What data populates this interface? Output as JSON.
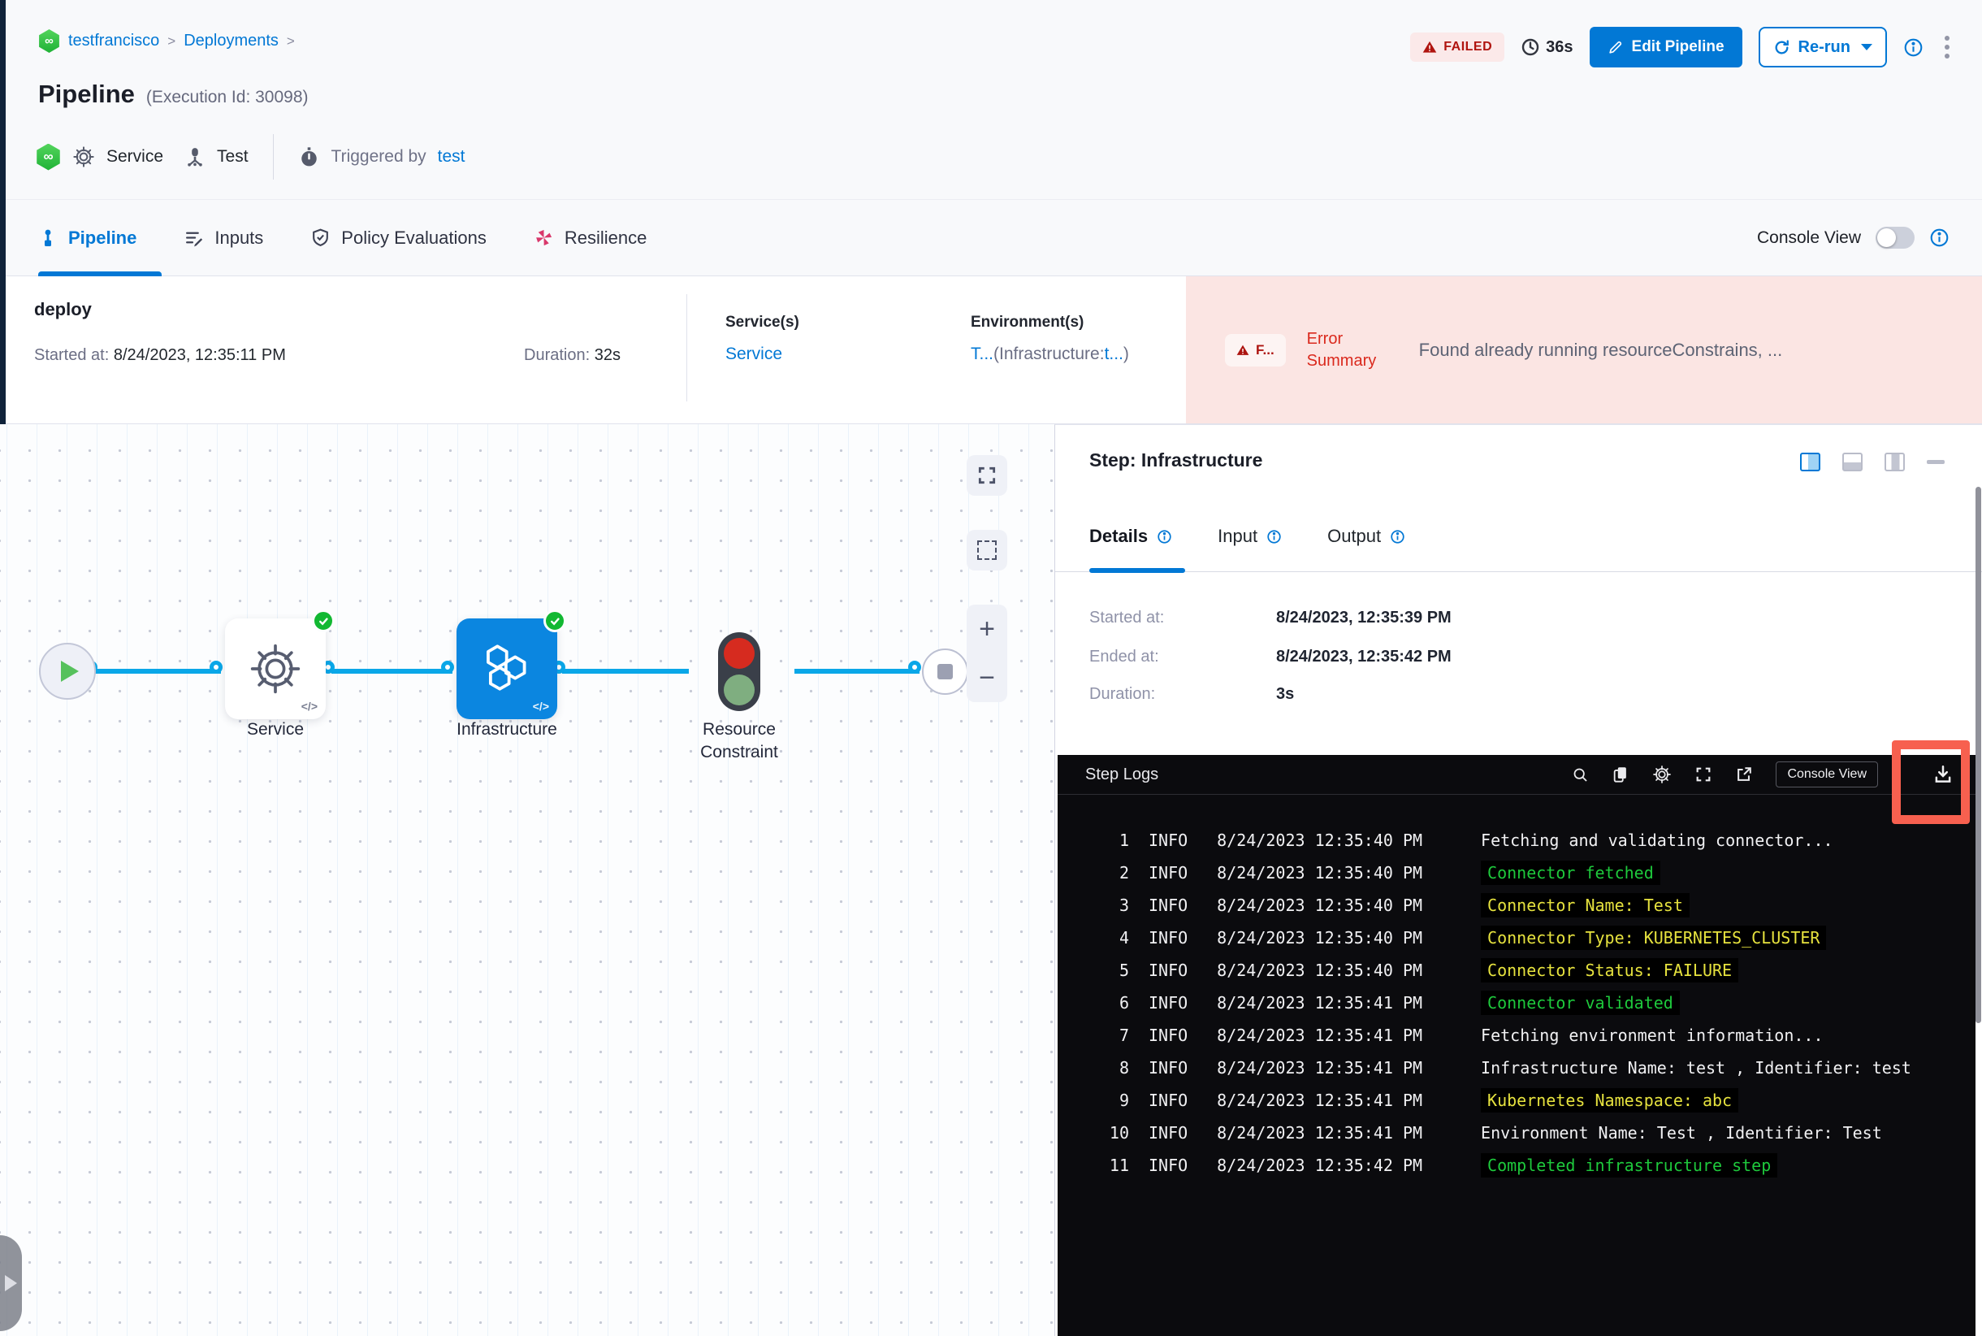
{
  "colors": {
    "accent_blue": "#0278d5",
    "failed_red": "#b0140f",
    "error_red": "#da291d",
    "error_bg_pink": "#fbe5e3",
    "node_blue": "#0b86e0",
    "edge_blue": "#0aa7e8",
    "success_green": "#12b832",
    "log_green": "#1ec93c",
    "log_yellow": "#e6e23e",
    "highlight_red": "#f7604f",
    "console_bg": "#0b0b0e"
  },
  "breadcrumb": {
    "project": "testfrancisco",
    "section": "Deployments",
    "separator": ">"
  },
  "header": {
    "title": "Pipeline",
    "execution_id": "(Execution Id: 30098)",
    "infinity_glyph": "∞",
    "service_name": "Service",
    "environment_name": "Test",
    "triggered_by_label": "Triggered by",
    "triggered_by_value": "test",
    "status_badge": "FAILED",
    "total_duration": "36s",
    "edit_pipeline_label": "Edit Pipeline",
    "rerun_label": "Re-run"
  },
  "tabs": {
    "pipeline": "Pipeline",
    "inputs": "Inputs",
    "policy_evaluations": "Policy Evaluations",
    "resilience": "Resilience",
    "console_view_label": "Console View"
  },
  "stage": {
    "name": "deploy",
    "started_label": "Started at: ",
    "started_value": "8/24/2023, 12:35:11 PM",
    "duration_label": "Duration: ",
    "duration_value": "32s",
    "services_label": "Service(s)",
    "service_link": "Service",
    "environments_label": "Environment(s)",
    "environment_primary": "T...",
    "environment_infra_prefix": "(Infrastructure:",
    "environment_infra_value": "t...",
    "environment_close": ")",
    "failed_chip": "F...",
    "error_summary_label": "Error Summary",
    "error_summary_text": "Found already running resourceConstrains, ..."
  },
  "graph": {
    "code_glyph": "</>",
    "nodes": [
      {
        "label": "Service"
      },
      {
        "label": "Infrastructure"
      },
      {
        "label": "Resource Constraint"
      }
    ]
  },
  "panel": {
    "title": "Step: Infrastructure",
    "tabs": {
      "details": "Details",
      "input": "Input",
      "output": "Output"
    },
    "details": {
      "started_label": "Started at:",
      "started_value": "8/24/2023, 12:35:39 PM",
      "ended_label": "Ended at:",
      "ended_value": "8/24/2023, 12:35:42 PM",
      "duration_label": "Duration:",
      "duration_value": "3s"
    }
  },
  "logs": {
    "title": "Step Logs",
    "console_view_button": "Console View",
    "lines": [
      {
        "n": "1",
        "level": "INFO",
        "time": "8/24/2023 12:35:40 PM",
        "message": "Fetching and validating connector...",
        "style": "plain"
      },
      {
        "n": "2",
        "level": "INFO",
        "time": "8/24/2023 12:35:40 PM",
        "message": "Connector fetched",
        "style": "success"
      },
      {
        "n": "3",
        "level": "INFO",
        "time": "8/24/2023 12:35:40 PM",
        "message": "Connector Name: Test",
        "style": "warn"
      },
      {
        "n": "4",
        "level": "INFO",
        "time": "8/24/2023 12:35:40 PM",
        "message": "Connector Type: KUBERNETES_CLUSTER",
        "style": "warn"
      },
      {
        "n": "5",
        "level": "INFO",
        "time": "8/24/2023 12:35:40 PM",
        "message": "Connector Status: FAILURE",
        "style": "warn"
      },
      {
        "n": "6",
        "level": "INFO",
        "time": "8/24/2023 12:35:41 PM",
        "message": "Connector validated",
        "style": "success"
      },
      {
        "n": "7",
        "level": "INFO",
        "time": "8/24/2023 12:35:41 PM",
        "message": "Fetching environment information...",
        "style": "plain"
      },
      {
        "n": "8",
        "level": "INFO",
        "time": "8/24/2023 12:35:41 PM",
        "message": "Infrastructure Name: test , Identifier: test",
        "style": "plain"
      },
      {
        "n": "9",
        "level": "INFO",
        "time": "8/24/2023 12:35:41 PM",
        "message": "Kubernetes Namespace: abc",
        "style": "warn"
      },
      {
        "n": "10",
        "level": "INFO",
        "time": "8/24/2023 12:35:41 PM",
        "message": "Environment Name: Test , Identifier: Test",
        "style": "plain"
      },
      {
        "n": "11",
        "level": "INFO",
        "time": "8/24/2023 12:35:42 PM",
        "message": "Completed infrastructure step",
        "style": "success"
      }
    ]
  }
}
